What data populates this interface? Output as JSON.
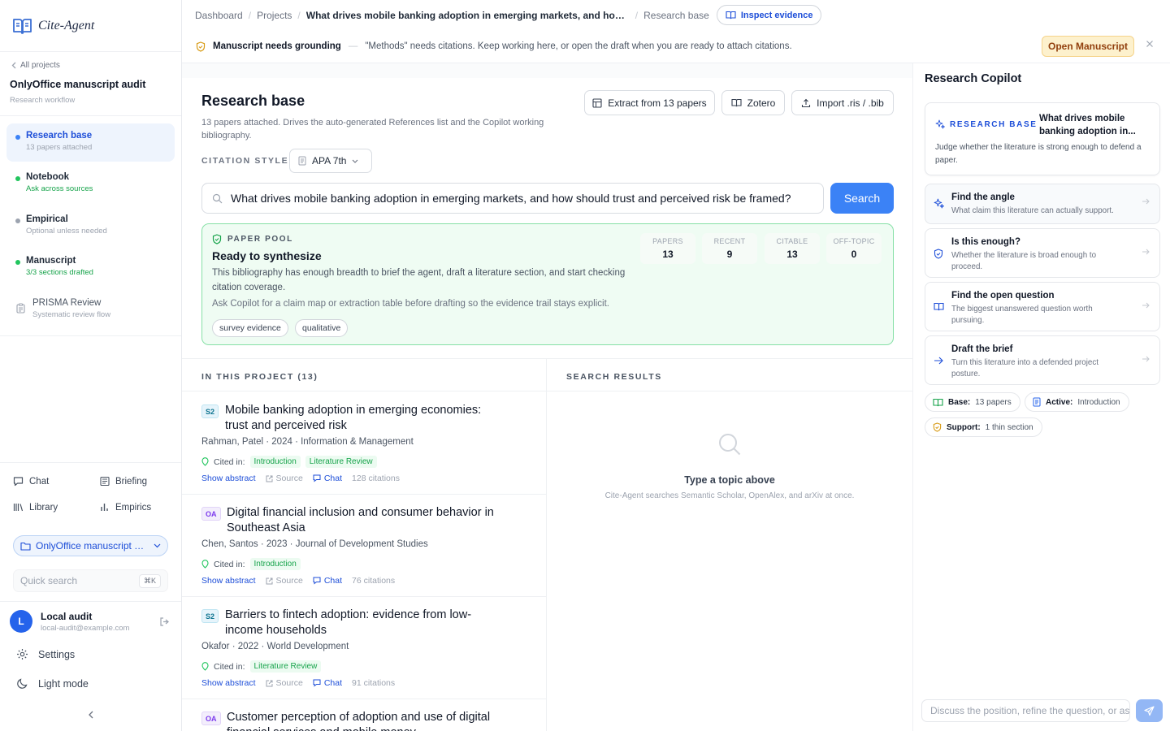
{
  "brand": {
    "name": "Cite-Agent"
  },
  "sidebar": {
    "back_label": "All projects",
    "project_name": "OnlyOffice manuscript audit",
    "project_sub": "Research workflow",
    "nav": [
      {
        "title": "Research base",
        "sub": "13 papers attached",
        "dot": "#3b82f6"
      },
      {
        "title": "Notebook",
        "sub": "Ask across sources",
        "dot": "#22c55e"
      },
      {
        "title": "Empirical",
        "sub": "Optional unless needed",
        "dot": "#9ca3af"
      },
      {
        "title": "Manuscript",
        "sub": "3/3 sections drafted",
        "dot": "#22c55e"
      },
      {
        "title": "PRISMA Review",
        "sub": "Systematic review flow"
      }
    ],
    "tools": {
      "chat": "Chat",
      "briefing": "Briefing",
      "library": "Library",
      "empirics": "Empirics"
    },
    "context_pill": "OnlyOffice manuscript audit",
    "quick_search": {
      "placeholder": "Quick search",
      "shortcut": "⌘K"
    },
    "user": {
      "initial": "L",
      "name": "Local audit",
      "email": "local-audit@example.com"
    },
    "settings": "Settings",
    "theme": "Light mode"
  },
  "topbar": {
    "crumbs": [
      "Dashboard",
      "Projects",
      "What drives mobile banking adoption in emerging markets, and how should trust and perceived risk be framed?",
      "Research base"
    ],
    "inspect_label": "Inspect evidence"
  },
  "banner": {
    "title": "Manuscript needs grounding",
    "dash": "—",
    "message": "\"Methods\" needs citations. Keep working here, or open the draft when you are ready to attach citations.",
    "action": "Open Manuscript"
  },
  "research_base": {
    "title": "Research base",
    "subtitle": "13 papers attached. Drives the auto-generated References list and the Copilot working bibliography.",
    "buttons": {
      "extract": "Extract from 13 papers",
      "zotero": "Zotero",
      "import": "Import .ris / .bib"
    },
    "citation_style_label": "CITATION STYLE",
    "citation_style": "APA 7th",
    "search_query": "What drives mobile banking adoption in emerging markets, and how should trust and perceived risk be framed?",
    "search_button": "Search"
  },
  "paper_pool": {
    "label": "PAPER POOL",
    "title": "Ready to synthesize",
    "description": "This bibliography has enough breadth to brief the agent, draft a literature section, and start checking citation coverage.",
    "hint": "Ask Copilot for a claim map or extraction table before drafting so the evidence trail stays explicit.",
    "tags": [
      "survey evidence",
      "qualitative"
    ],
    "stats": [
      {
        "label": "PAPERS",
        "value": "13"
      },
      {
        "label": "RECENT",
        "value": "9"
      },
      {
        "label": "CITABLE",
        "value": "13"
      },
      {
        "label": "OFF-TOPIC",
        "value": "0"
      }
    ]
  },
  "project_list": {
    "header": "IN THIS PROJECT (13)",
    "cited_label": "Cited in:",
    "show_abstract": "Show abstract",
    "source": "Source",
    "chat": "Chat",
    "papers": [
      {
        "badge": "S2",
        "title": "Mobile banking adoption in emerging economies: trust and perceived risk",
        "meta": "Rahman, Patel · 2024 · Information & Management",
        "cited": [
          "Introduction",
          "Literature Review"
        ],
        "citations": "128 citations"
      },
      {
        "badge": "OA",
        "title": "Digital financial inclusion and consumer behavior in Southeast Asia",
        "meta": "Chen, Santos · 2023 · Journal of Development Studies",
        "cited": [
          "Introduction"
        ],
        "citations": "76 citations"
      },
      {
        "badge": "S2",
        "title": "Barriers to fintech adoption: evidence from low-income households",
        "meta": "Okafor · 2022 · World Development",
        "cited": [
          "Literature Review"
        ],
        "citations": "91 citations"
      },
      {
        "badge": "OA",
        "title": "Customer perception of adoption and use of digital financial services and mobile money"
      }
    ]
  },
  "search_results": {
    "header": "SEARCH RESULTS",
    "empty_title": "Type a topic above",
    "empty_sub": "Cite-Agent searches Semantic Scholar, OpenAlex, and arXiv at once."
  },
  "copilot": {
    "title": "Research Copilot",
    "card": {
      "tag": "RESEARCH BASE",
      "question": "What drives mobile banking adoption in...",
      "description": "Judge whether the literature is strong enough to defend a paper."
    },
    "actions": [
      {
        "title": "Find the angle",
        "desc": "What claim this literature can actually support."
      },
      {
        "title": "Is this enough?",
        "desc": "Whether the literature is broad enough to proceed."
      },
      {
        "title": "Find the open question",
        "desc": "The biggest unanswered question worth pursuing."
      },
      {
        "title": "Draft the brief",
        "desc": "Turn this literature into a defended project posture."
      }
    ],
    "pills": {
      "base_label": "Base:",
      "base_value": "13 papers",
      "active_label": "Active:",
      "active_value": "Introduction",
      "support_label": "Support:",
      "support_value": "1 thin section"
    },
    "composer_placeholder": "Discuss the position, refine the question, or ask for a brief"
  }
}
